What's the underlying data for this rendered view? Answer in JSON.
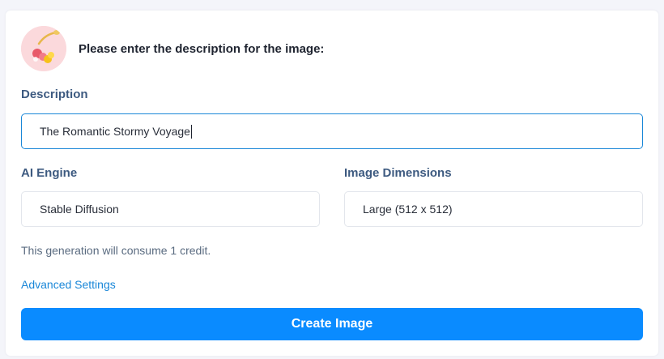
{
  "header": {
    "avatar_icon": "dessert-fruit-illustration-icon",
    "prompt_title": "Please enter the description for the image:"
  },
  "description": {
    "label": "Description",
    "value": "The Romantic Stormy Voyage"
  },
  "ai_engine": {
    "label": "AI Engine",
    "value": "Stable Diffusion"
  },
  "image_dimensions": {
    "label": "Image Dimensions",
    "value": "Large (512 x 512)"
  },
  "credit_note": "This generation will consume 1 credit.",
  "advanced_settings_link": "Advanced Settings",
  "create_button_label": "Create Image",
  "colors": {
    "primary_button": "#0a8bff",
    "link": "#1a87d8",
    "label": "#3d5a80",
    "avatar_bg": "#fbd9dc"
  }
}
